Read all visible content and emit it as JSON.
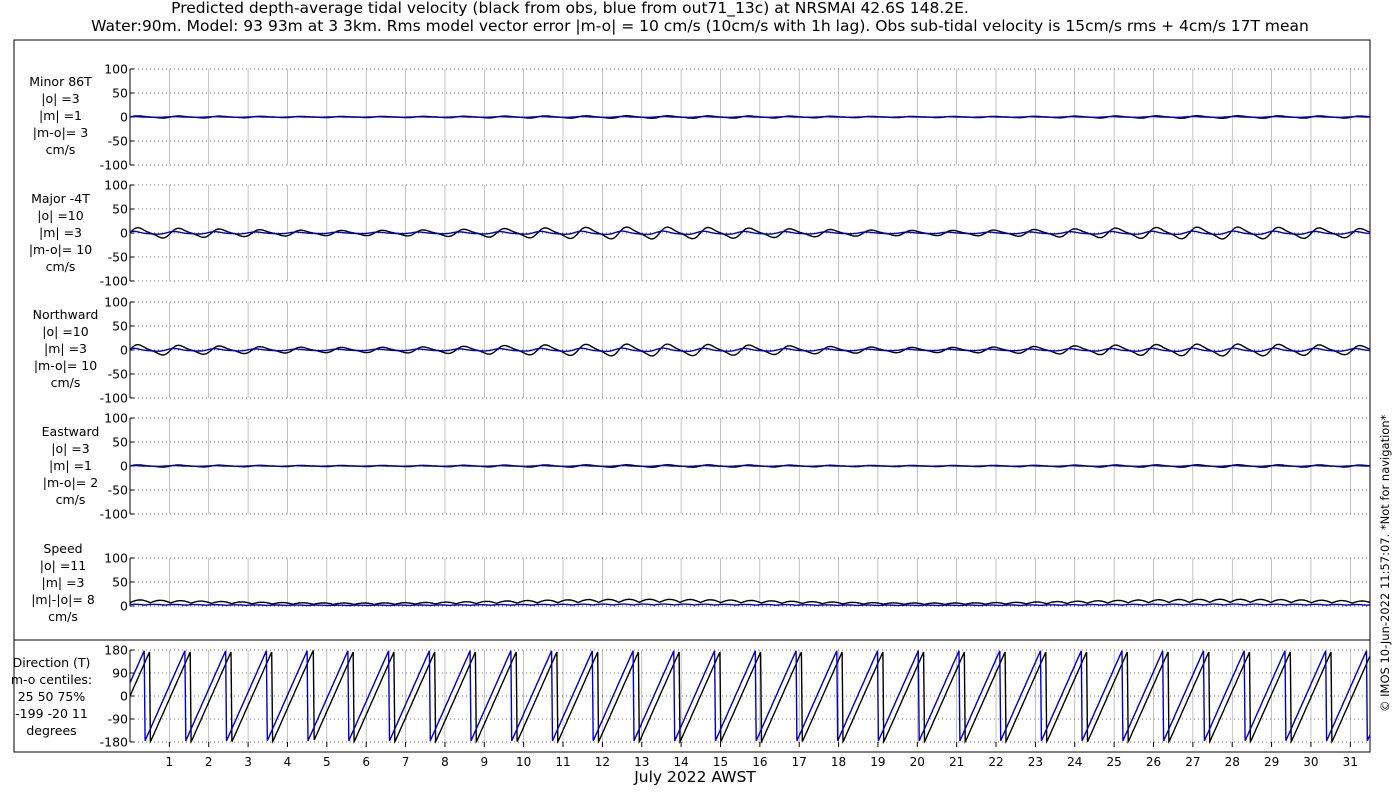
{
  "title_line1": "Predicted depth-average tidal velocity (black from obs, blue from out71_13c) at NRSMAI 42.6S 148.2E.",
  "title_line2": "Water:90m. Model: 93 93m at 3 3km. Rms model vector error |m-o| = 10 cm/s (10cm/s with 1h lag). Obs sub-tidal velocity is 15cm/s rms + 4cm/s 17T mean",
  "xlabel": "July 2022 AWST",
  "credit": "© IMOS 10-Jun-2022 11:57:07. *Not for navigation*",
  "colors": {
    "obs": "#000000",
    "model": "#0000cc",
    "grid": "#9a9a9a"
  },
  "panel_labels": {
    "minor": [
      "Minor 86T",
      "|o| =3",
      "|m| =1",
      "|m-o|= 3",
      "cm/s"
    ],
    "major": [
      "Major -4T",
      "|o| =10",
      "|m| =3",
      "|m-o|= 10",
      "cm/s"
    ],
    "north": [
      "Northward",
      "|o| =10",
      "|m| =3",
      "|m-o|= 10",
      "cm/s"
    ],
    "east": [
      "Eastward",
      "|o| =3",
      "|m| =1",
      "|m-o|= 2",
      "cm/s"
    ],
    "speed": [
      "Speed",
      "|o| =11",
      "|m| =3",
      "|m|-|o|= 8",
      "cm/s"
    ],
    "dir": [
      "Direction (T)",
      "m-o centiles:",
      "25  50  75%",
      "-199  -20   11",
      "degrees"
    ]
  },
  "chart_data": [
    {
      "type": "line",
      "name": "minor",
      "ylim": [
        -100,
        100
      ],
      "yticks": [
        "100",
        "50",
        "0",
        "-50",
        "-100"
      ],
      "xlim": [
        0,
        31.5
      ],
      "xticks": [
        "1",
        "2",
        "3",
        "4",
        "5",
        "6",
        "7",
        "8",
        "9",
        "10",
        "11",
        "12",
        "13",
        "14",
        "15",
        "16",
        "17",
        "18",
        "19",
        "20",
        "21",
        "22",
        "23",
        "24",
        "25",
        "26",
        "27",
        "28",
        "29",
        "30",
        "31"
      ],
      "series": [
        {
          "name": "obs",
          "amplitude": 3
        },
        {
          "name": "model",
          "amplitude": 1
        }
      ]
    },
    {
      "type": "line",
      "name": "major",
      "ylim": [
        -100,
        100
      ],
      "yticks": [
        "100",
        "50",
        "0",
        "-50",
        "-100"
      ],
      "xlim": [
        0,
        31.5
      ],
      "series": [
        {
          "name": "obs",
          "amplitude": 14
        },
        {
          "name": "model",
          "amplitude": 4
        }
      ]
    },
    {
      "type": "line",
      "name": "north",
      "ylim": [
        -100,
        100
      ],
      "yticks": [
        "100",
        "50",
        "0",
        "-50",
        "-100"
      ],
      "xlim": [
        0,
        31.5
      ],
      "series": [
        {
          "name": "obs",
          "amplitude": 14
        },
        {
          "name": "model",
          "amplitude": 4
        }
      ]
    },
    {
      "type": "line",
      "name": "east",
      "ylim": [
        -100,
        100
      ],
      "yticks": [
        "100",
        "50",
        "0",
        "-50",
        "-100"
      ],
      "xlim": [
        0,
        31.5
      ],
      "series": [
        {
          "name": "obs",
          "amplitude": 3
        },
        {
          "name": "model",
          "amplitude": 1
        }
      ]
    },
    {
      "type": "line",
      "name": "speed",
      "ylim": [
        0,
        100
      ],
      "yticks": [
        "100",
        "50",
        "0"
      ],
      "xlim": [
        0,
        31.5
      ],
      "series": [
        {
          "name": "obs",
          "amplitude": 14
        },
        {
          "name": "model",
          "amplitude": 4
        }
      ]
    },
    {
      "type": "line",
      "name": "direction",
      "ylim": [
        -180,
        180
      ],
      "yticks": [
        "180",
        "90",
        "0",
        "-90",
        "-180"
      ],
      "xlim": [
        0,
        31.5
      ],
      "series": [
        {
          "name": "obs"
        },
        {
          "name": "model"
        }
      ]
    }
  ]
}
